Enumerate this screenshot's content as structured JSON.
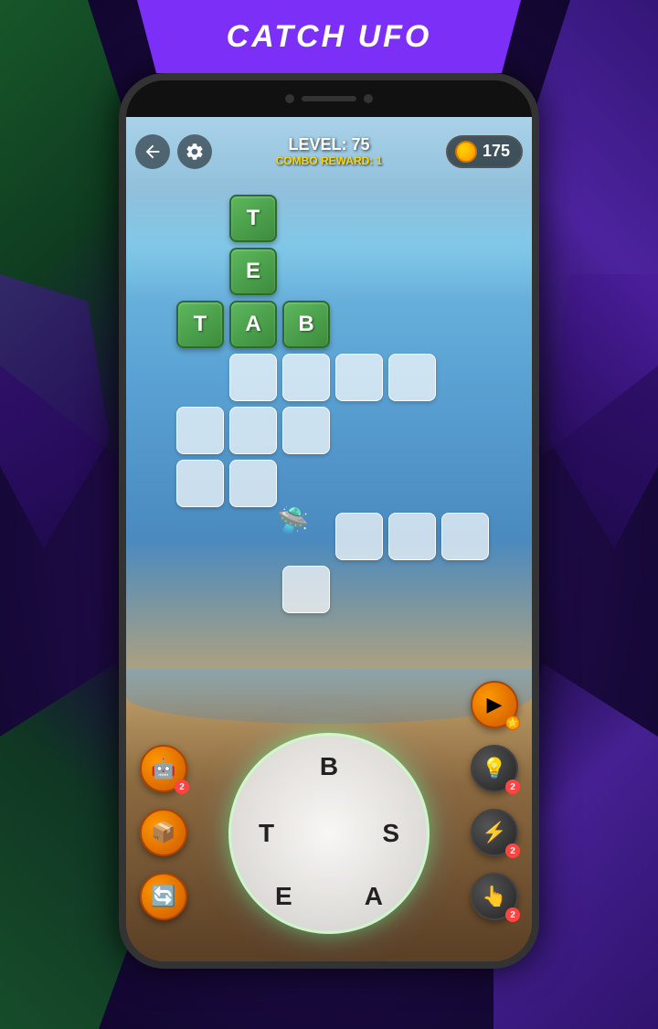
{
  "banner": {
    "title": "CATCH UFO"
  },
  "header": {
    "level_label": "LEVEL: 75",
    "combo_reward": "COMBO REWARD: 1",
    "coins": "175",
    "back_icon": "back-arrow",
    "settings_icon": "gear"
  },
  "crossword": {
    "cells": [
      {
        "letter": "T",
        "type": "green",
        "col": 1,
        "row": 0
      },
      {
        "letter": "E",
        "type": "green",
        "col": 1,
        "row": 1
      },
      {
        "letter": "T",
        "type": "green",
        "col": 0,
        "row": 2
      },
      {
        "letter": "A",
        "type": "green",
        "col": 1,
        "row": 2
      },
      {
        "letter": "B",
        "type": "green",
        "col": 2,
        "row": 2
      },
      {
        "letter": "",
        "type": "empty",
        "col": 1,
        "row": 3
      },
      {
        "letter": "",
        "type": "empty",
        "col": 2,
        "row": 3
      },
      {
        "letter": "",
        "type": "empty",
        "col": 0,
        "row": 4
      },
      {
        "letter": "",
        "type": "empty",
        "col": 1,
        "row": 4
      },
      {
        "letter": "",
        "type": "empty",
        "col": 2,
        "row": 4
      },
      {
        "letter": "",
        "type": "empty",
        "col": 0,
        "row": 5
      },
      {
        "letter": "",
        "type": "empty",
        "col": 1,
        "row": 5
      },
      {
        "letter": "",
        "type": "empty",
        "col": 2,
        "row": 6
      },
      {
        "letter": "",
        "type": "empty",
        "col": 3,
        "row": 6
      },
      {
        "letter": "",
        "type": "empty",
        "col": 4,
        "row": 6
      },
      {
        "letter": "",
        "type": "empty",
        "col": 1,
        "row": 7
      },
      {
        "letter": "",
        "type": "empty",
        "col": 3,
        "row": 5
      },
      {
        "letter": "",
        "type": "empty",
        "col": 4,
        "row": 5
      },
      {
        "letter": "",
        "type": "empty",
        "col": 3,
        "row": 3
      },
      {
        "letter": "",
        "type": "empty",
        "col": 4,
        "row": 3
      }
    ]
  },
  "combo": {
    "number": "1",
    "label": "COMBO"
  },
  "wheel": {
    "letters": [
      "B",
      "T",
      "S",
      "E",
      "A"
    ]
  },
  "buttons": {
    "video_reward": "▶",
    "hint": "💡",
    "box": "📦",
    "lightning": "⚡",
    "swap": "🔄",
    "hand": "👆",
    "badge_2": "2"
  }
}
